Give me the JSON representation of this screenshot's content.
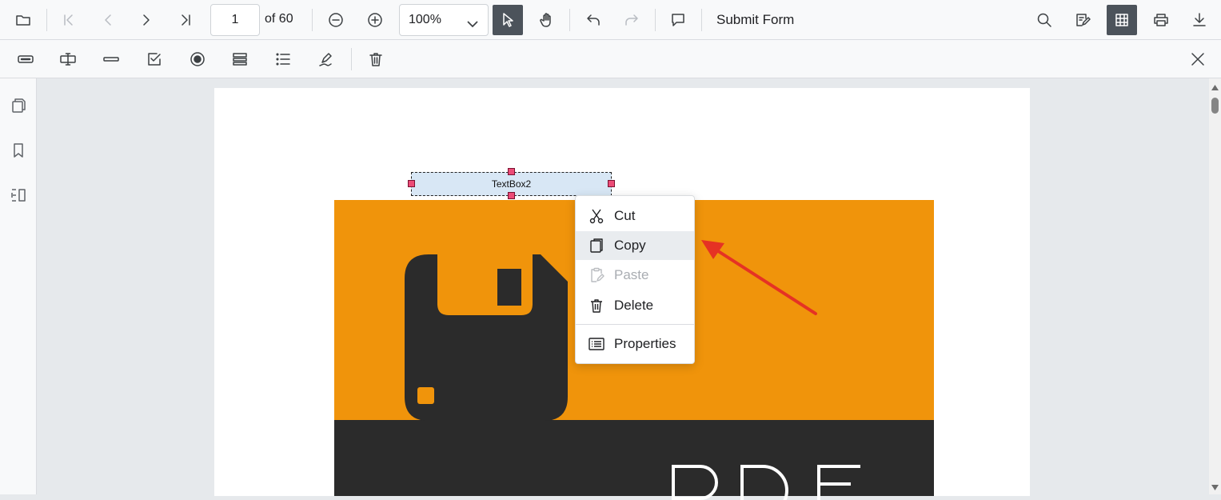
{
  "toolbar": {
    "open_icon": "folder-icon",
    "first_icon": "first-page-icon",
    "prev_icon": "previous-page-icon",
    "next_icon": "next-page-icon",
    "last_icon": "last-page-icon",
    "page_number": "1",
    "page_total": "of 60",
    "zoom_value": "100%",
    "submit_form_label": "Submit Form",
    "active_tool": "select"
  },
  "form_designer_toolbar": {
    "tools": [
      "textbox-icon",
      "password-icon",
      "line-field-icon",
      "checkbox-icon",
      "radio-button-icon",
      "dropdown-icon",
      "listbox-icon",
      "signature-icon",
      "delete-icon"
    ],
    "close_icon": "close-icon"
  },
  "sidepanel": {
    "icons": [
      "thumbnails-icon",
      "bookmarks-icon",
      "organize-pages-icon"
    ]
  },
  "document": {
    "field_label": "TextBox2",
    "banner_colors": {
      "orange": "#f0940b",
      "dark": "#2b2b2b"
    }
  },
  "context_menu": {
    "items": [
      {
        "label": "Cut",
        "icon": "scissors-icon",
        "state": "normal"
      },
      {
        "label": "Copy",
        "icon": "copy-icon",
        "state": "hover"
      },
      {
        "label": "Paste",
        "icon": "paste-icon",
        "state": "disabled"
      },
      {
        "label": "Delete",
        "icon": "trash-icon",
        "state": "normal"
      },
      {
        "label": "Properties",
        "icon": "properties-icon",
        "state": "normal"
      }
    ]
  },
  "colors": {
    "accent_active_tool": "#4c535b",
    "annotation_arrow": "#e53224",
    "handle": "#ec4c77"
  }
}
